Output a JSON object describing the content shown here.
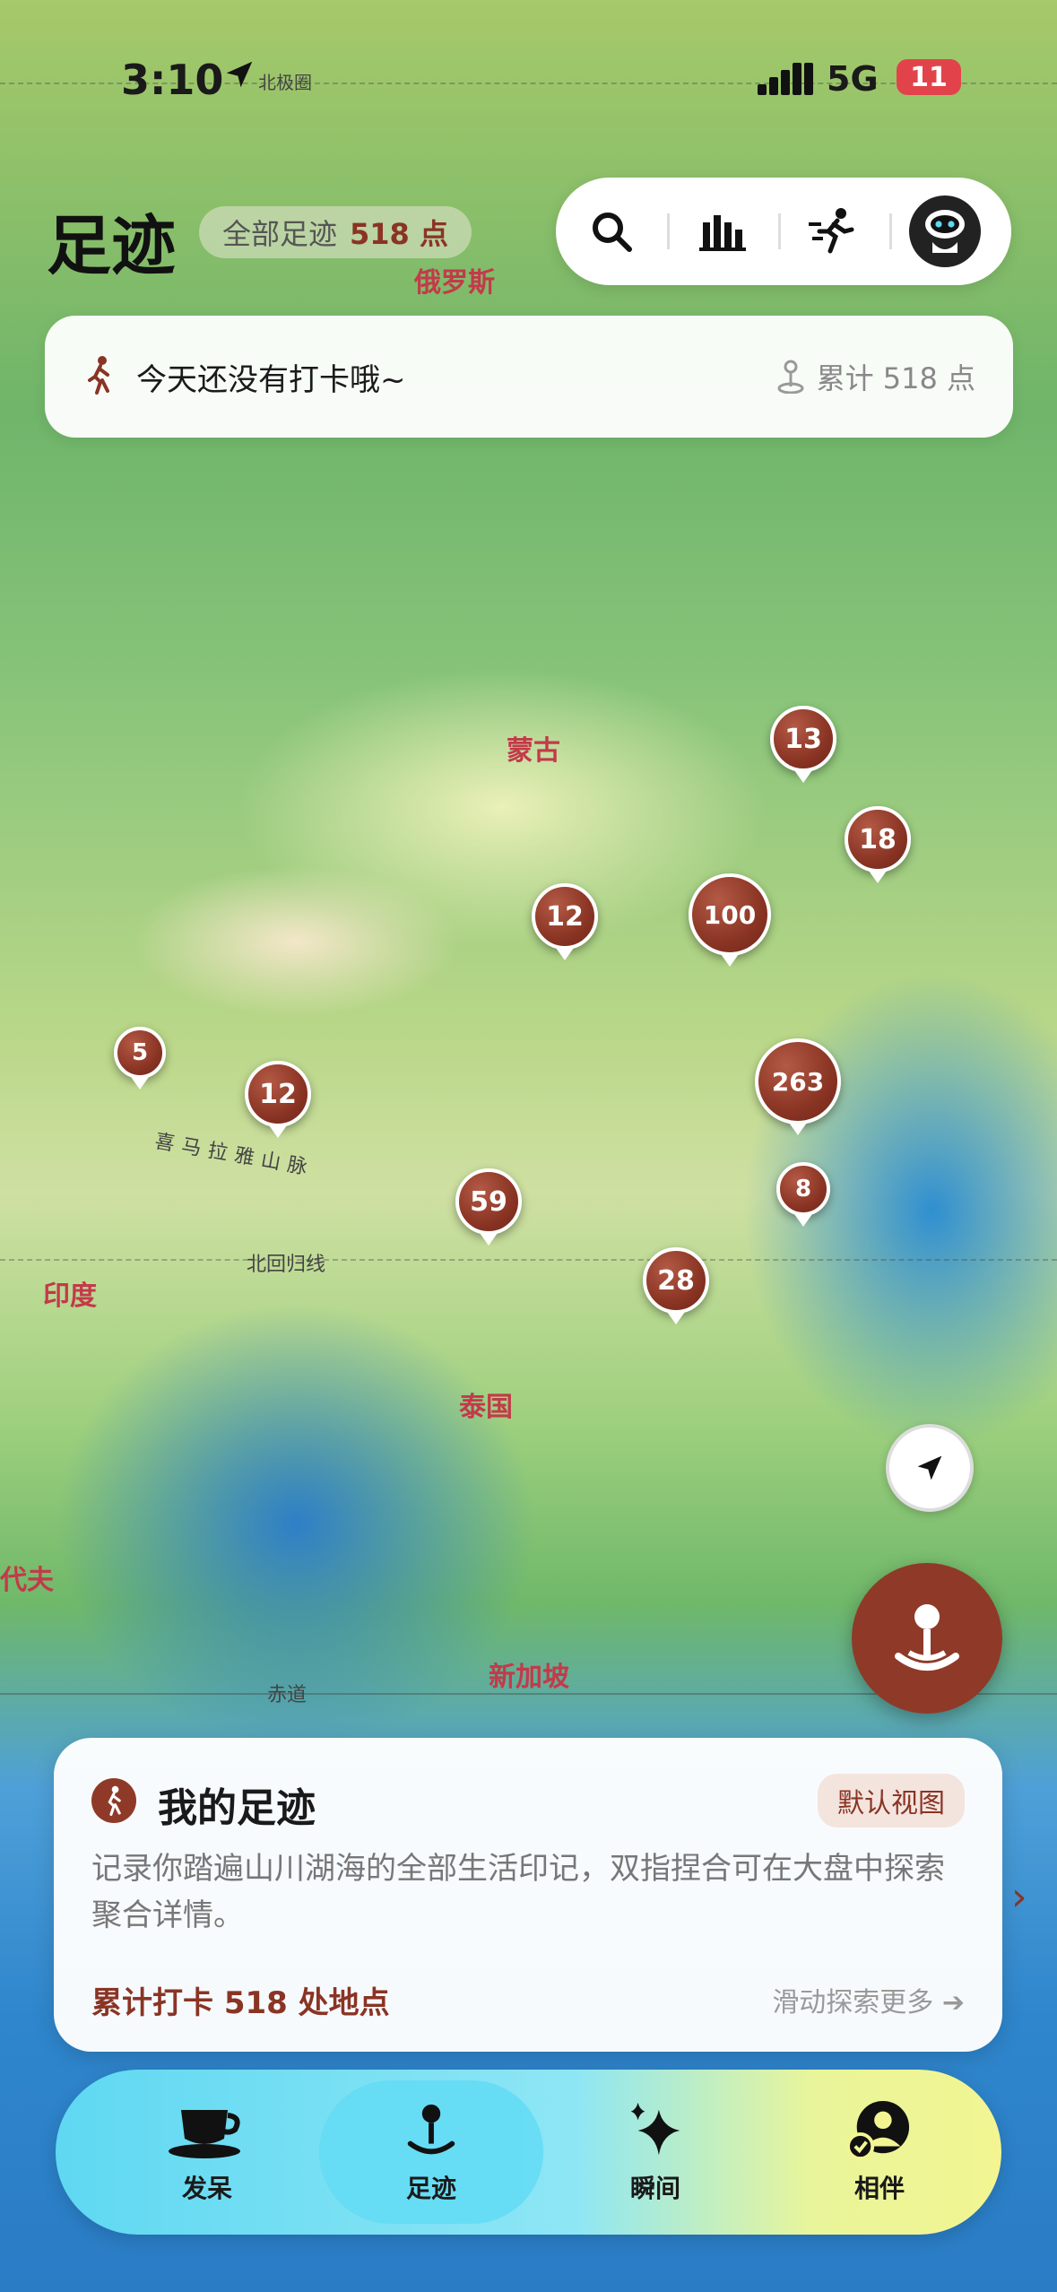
{
  "status_bar": {
    "time": "3:10",
    "map_polar_label": "北极圈",
    "network": "5G",
    "battery": "11"
  },
  "header": {
    "title": "足迹",
    "total_label": "全部足迹",
    "total_value": "518 点"
  },
  "toolbar": {
    "icons": [
      "search-icon",
      "bar-chart-icon",
      "run-icon",
      "avatar"
    ]
  },
  "checkin_card": {
    "message": "今天还没有打卡哦~",
    "cumulative": "累计 518 点"
  },
  "map": {
    "labels": {
      "russia": "俄罗斯",
      "mongolia": "蒙古",
      "himalaya": "喜马拉雅山脉",
      "tropic": "北回归线",
      "india": "印度",
      "thailand": "泰国",
      "singapore": "新加坡",
      "equator": "赤道",
      "maldives": "代夫"
    },
    "clusters": [
      "13",
      "18",
      "12",
      "100",
      "5",
      "12",
      "263",
      "8",
      "59",
      "28"
    ]
  },
  "sheet": {
    "title": "我的足迹",
    "view_badge": "默认视图",
    "description": "记录你踏遍山川湖海的全部生活印记，双指捏合可在大盘中探索聚合详情。",
    "count": "累计打卡 518 处地点",
    "more": "滑动探索更多 ➔"
  },
  "tabbar": {
    "tabs": [
      {
        "label": "发呆",
        "icon": "coffee-cup-icon"
      },
      {
        "label": "足迹",
        "icon": "map-pin-icon"
      },
      {
        "label": "瞬间",
        "icon": "sparkle-icon"
      },
      {
        "label": "相伴",
        "icon": "companion-icon"
      }
    ],
    "active": "足迹"
  },
  "colors": {
    "accent": "#8a3424",
    "label_red": "#c33a4a",
    "tab_cyan": "#5fd8f2",
    "tab_yellow": "#f2f592"
  }
}
